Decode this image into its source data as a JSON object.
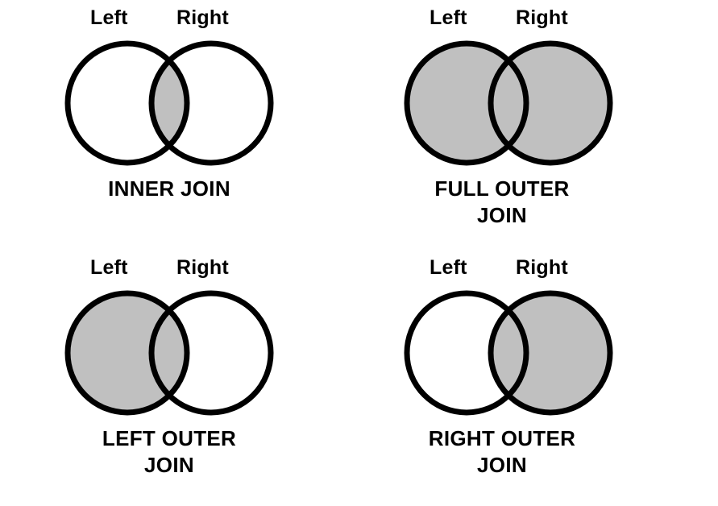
{
  "page": {
    "title": "SQL JOIN types Venn diagrams",
    "background_color": "#ffffff",
    "stroke_color": "#000000",
    "shade_color": "#c0c0c0",
    "unshaded_color": "#ffffff"
  },
  "diagrams": [
    {
      "id": "inner-join",
      "position": "top-left",
      "left_label": "Left",
      "right_label": "Right",
      "caption_lines": [
        "INNER JOIN"
      ],
      "caption_text": "INNER JOIN",
      "shaded_regions": [
        "intersection"
      ],
      "left_only_shaded": false,
      "right_only_shaded": false,
      "intersection_shaded": true
    },
    {
      "id": "full-outer-join",
      "position": "top-right",
      "left_label": "Left",
      "right_label": "Right",
      "caption_lines": [
        "FULL OUTER",
        "JOIN"
      ],
      "caption_text": "FULL OUTER JOIN",
      "shaded_regions": [
        "left-only",
        "intersection",
        "right-only"
      ],
      "left_only_shaded": true,
      "right_only_shaded": true,
      "intersection_shaded": true
    },
    {
      "id": "left-outer-join",
      "position": "bottom-left",
      "left_label": "Left",
      "right_label": "Right",
      "caption_lines": [
        "LEFT OUTER",
        "JOIN"
      ],
      "caption_text": "LEFT OUTER JOIN",
      "shaded_regions": [
        "left-only",
        "intersection"
      ],
      "left_only_shaded": true,
      "right_only_shaded": false,
      "intersection_shaded": true
    },
    {
      "id": "right-outer-join",
      "position": "bottom-right",
      "left_label": "Left",
      "right_label": "Right",
      "caption_lines": [
        "RIGHT OUTER",
        "JOIN"
      ],
      "caption_text": "RIGHT OUTER JOIN",
      "shaded_regions": [
        "intersection",
        "right-only"
      ],
      "left_only_shaded": false,
      "right_only_shaded": true,
      "intersection_shaded": true
    }
  ]
}
